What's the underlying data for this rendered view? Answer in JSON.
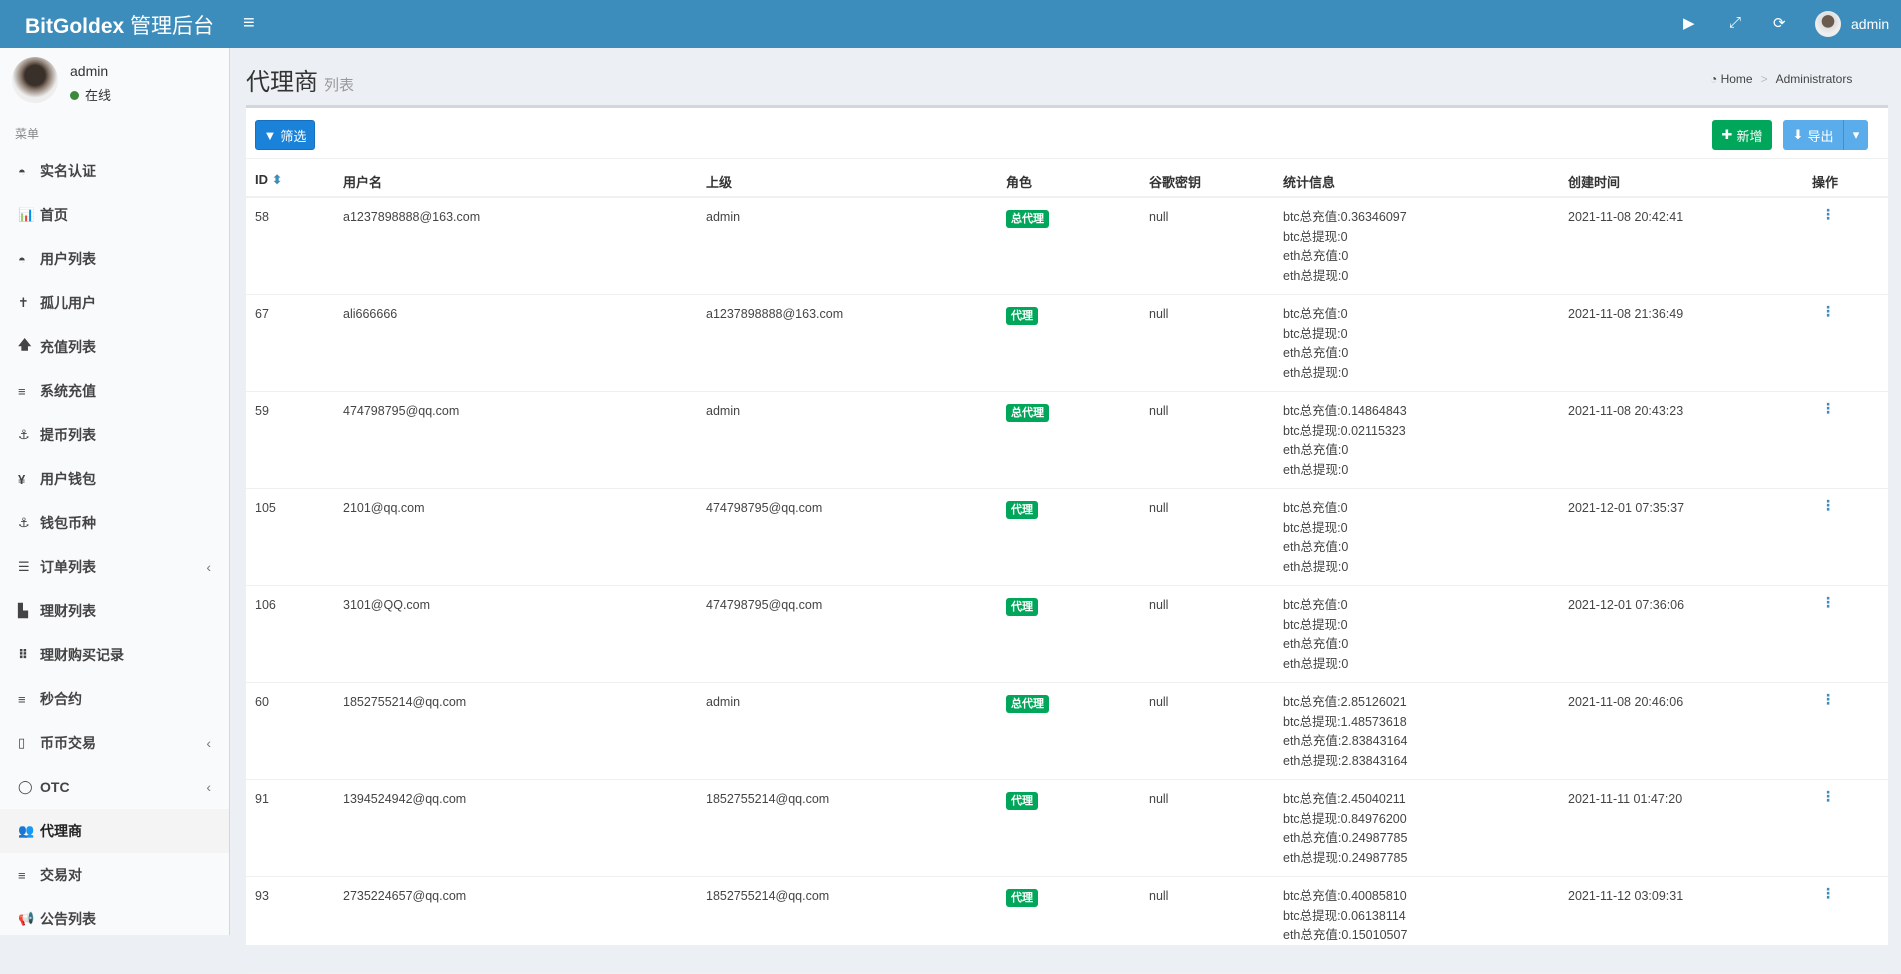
{
  "header": {
    "brand": "BitGoldex",
    "brand_cn": "管理后台",
    "user": "admin"
  },
  "sidebar": {
    "user": "admin",
    "status": "在线",
    "menu_header": "菜单",
    "items": [
      {
        "label": "实名认证",
        "icon": "drupal-icon",
        "glyph": "◓"
      },
      {
        "label": "首页",
        "icon": "bar-chart-icon",
        "glyph": "📊"
      },
      {
        "label": "用户列表",
        "icon": "drupal-icon",
        "glyph": "◓"
      },
      {
        "label": "孤儿用户",
        "icon": "child-icon",
        "glyph": "✝"
      },
      {
        "label": "充值列表",
        "icon": "arrow-up-icon",
        "glyph": "🡅"
      },
      {
        "label": "系统充值",
        "icon": "list-icon",
        "glyph": "≡"
      },
      {
        "label": "提币列表",
        "icon": "anchor-icon",
        "glyph": "⚓"
      },
      {
        "label": "用户钱包",
        "icon": "yen-icon",
        "glyph": "¥"
      },
      {
        "label": "钱包币种",
        "icon": "anchor-icon",
        "glyph": "⚓"
      },
      {
        "label": "订单列表",
        "icon": "align-center-icon",
        "glyph": "☰",
        "chevron": "‹"
      },
      {
        "label": "理财列表",
        "icon": "fax-icon",
        "glyph": "▙"
      },
      {
        "label": "理财购买记录",
        "icon": "braille-icon",
        "glyph": "⠿"
      },
      {
        "label": "秒合约",
        "icon": "list-icon",
        "glyph": "≡"
      },
      {
        "label": "币币交易",
        "icon": "building-icon",
        "glyph": "▯",
        "chevron": "‹"
      },
      {
        "label": "OTC",
        "icon": "circle-notch-icon",
        "glyph": "◯",
        "chevron": "‹"
      },
      {
        "label": "代理商",
        "icon": "users-icon",
        "glyph": "👥",
        "active": true
      },
      {
        "label": "交易对",
        "icon": "list-icon",
        "glyph": "≡"
      },
      {
        "label": "公告列表",
        "icon": "bullhorn-icon",
        "glyph": "📢"
      }
    ]
  },
  "page": {
    "title": "代理商",
    "subtitle": "列表",
    "breadcrumb": [
      "Home",
      "Administrators"
    ]
  },
  "toolbar": {
    "filter": "筛选",
    "add": "新增",
    "export": "导出"
  },
  "table": {
    "columns": [
      "ID",
      "用户名",
      "上级",
      "角色",
      "谷歌密钥",
      "统计信息",
      "创建时间",
      "操作"
    ],
    "rows": [
      {
        "id": "58",
        "username": "a1237898888@163.com",
        "parent": "admin",
        "role": "总代理",
        "google": "null",
        "stats": [
          "btc总充值:0.36346097",
          "btc总提现:0",
          "eth总充值:0",
          "eth总提现:0"
        ],
        "created": "2021-11-08 20:42:41"
      },
      {
        "id": "67",
        "username": "ali666666",
        "parent": "a1237898888@163.com",
        "role": "代理",
        "google": "null",
        "stats": [
          "btc总充值:0",
          "btc总提现:0",
          "eth总充值:0",
          "eth总提现:0"
        ],
        "created": "2021-11-08 21:36:49"
      },
      {
        "id": "59",
        "username": "474798795@qq.com",
        "parent": "admin",
        "role": "总代理",
        "google": "null",
        "stats": [
          "btc总充值:0.14864843",
          "btc总提现:0.02115323",
          "eth总充值:0",
          "eth总提现:0"
        ],
        "created": "2021-11-08 20:43:23"
      },
      {
        "id": "105",
        "username": "2101@qq.com",
        "parent": "474798795@qq.com",
        "role": "代理",
        "google": "null",
        "stats": [
          "btc总充值:0",
          "btc总提现:0",
          "eth总充值:0",
          "eth总提现:0"
        ],
        "created": "2021-12-01 07:35:37"
      },
      {
        "id": "106",
        "username": "3101@QQ.com",
        "parent": "474798795@qq.com",
        "role": "代理",
        "google": "null",
        "stats": [
          "btc总充值:0",
          "btc总提现:0",
          "eth总充值:0",
          "eth总提现:0"
        ],
        "created": "2021-12-01 07:36:06"
      },
      {
        "id": "60",
        "username": "1852755214@qq.com",
        "parent": "admin",
        "role": "总代理",
        "google": "null",
        "stats": [
          "btc总充值:2.85126021",
          "btc总提现:1.48573618",
          "eth总充值:2.83843164",
          "eth总提现:2.83843164"
        ],
        "created": "2021-11-08 20:46:06"
      },
      {
        "id": "91",
        "username": "1394524942@qq.com",
        "parent": "1852755214@qq.com",
        "role": "代理",
        "google": "null",
        "stats": [
          "btc总充值:2.45040211",
          "btc总提现:0.84976200",
          "eth总充值:0.24987785",
          "eth总提现:0.24987785"
        ],
        "created": "2021-11-11 01:47:20"
      },
      {
        "id": "93",
        "username": "2735224657@qq.com",
        "parent": "1852755214@qq.com",
        "role": "代理",
        "google": "null",
        "stats": [
          "btc总充值:0.40085810",
          "btc总提现:0.06138114",
          "eth总充值:0.15010507"
        ],
        "created": "2021-11-12 03:09:31"
      }
    ]
  }
}
